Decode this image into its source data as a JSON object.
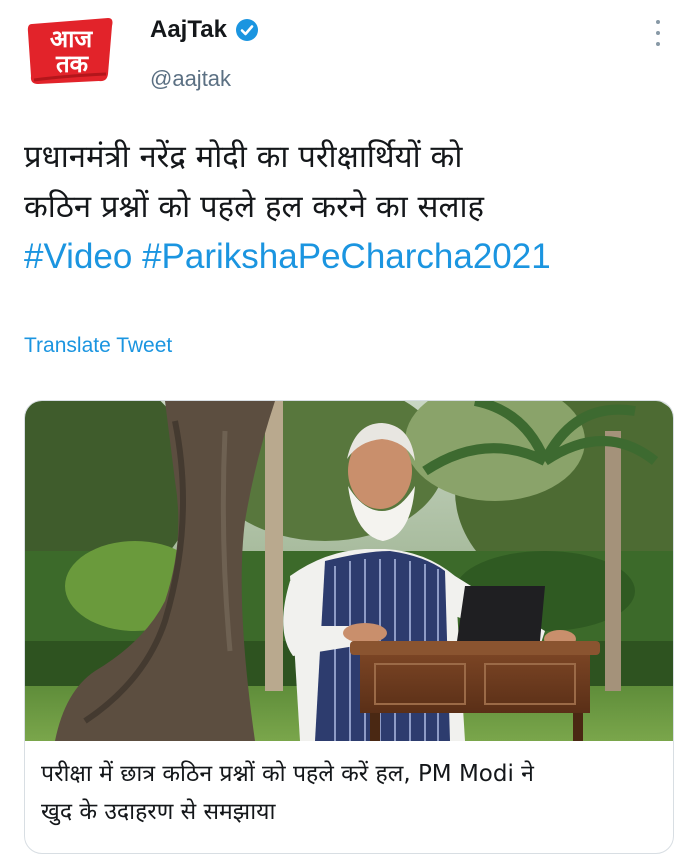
{
  "author": {
    "display_name": "AajTak",
    "handle": "@aajtak",
    "avatar_text_line1": "आज",
    "avatar_text_line2": "तक"
  },
  "tweet": {
    "text_line1": "प्रधानमंत्री नरेंद्र मोदी का  परीक्षार्थियों को",
    "text_line2": "कठिन प्रश्नों को पहले हल करने का सलाह",
    "hashtags": [
      "#Video",
      "#ParikshaPeCharcha2021"
    ]
  },
  "translate_label": "Translate Tweet",
  "card": {
    "caption_line1": "परीक्षा में छात्र कठिन प्रश्नों को पहले करें हल, PM Modi ने",
    "caption_line2": "खुद के उदाहरण से समझाया"
  },
  "colors": {
    "link": "#1b95e0",
    "text": "#14171a",
    "secondary": "#5b7083",
    "brand_red": "#e2232a"
  },
  "icons": [
    "verified-badge-icon",
    "more-options-icon",
    "aajtak-logo"
  ]
}
